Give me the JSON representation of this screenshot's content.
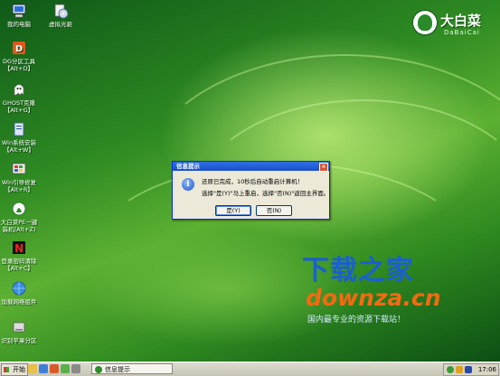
{
  "desktop": {
    "icons": [
      {
        "label": "我的电脑",
        "icon": "computer-icon"
      },
      {
        "label": "虚拟光驱",
        "icon": "cd-drive-icon"
      },
      {
        "label": "DG分区工具",
        "sub": "【Alt+D】",
        "icon": "partition-tool-icon"
      },
      {
        "label": "GHOST克隆",
        "sub": "【Alt+G】",
        "icon": "ghost-clone-icon"
      },
      {
        "label": "Win系统安装",
        "sub": "【Alt+W】",
        "icon": "windows-install-icon"
      },
      {
        "label": "Win引导修复",
        "sub": "【Alt+R】",
        "icon": "boot-repair-icon"
      },
      {
        "label": "大白菜PE一键",
        "sub": "装机(Alt+Z)",
        "icon": "dabaicai-onekey-icon"
      },
      {
        "label": "登录密码清除",
        "sub": "【Alt+C】",
        "icon": "password-clear-icon"
      },
      {
        "label": "加载网络组件",
        "icon": "network-load-icon"
      },
      {
        "label": "识别苹果分区",
        "icon": "apple-partition-icon"
      }
    ]
  },
  "logo": {
    "cn": "大白菜",
    "en": "DaBaiCai"
  },
  "watermark": {
    "cn": "下载之家",
    "url": "downza.cn",
    "slogan": "国内最专业的资源下载站！"
  },
  "dialog": {
    "title": "信息提示",
    "close": "×",
    "icon_glyph": "i",
    "message_line1": "还原已完成，10秒后自动重启计算机！",
    "message_line2": "选择\"是(Y)\"马上重启，选择\"否(N)\"返回主界面。",
    "yes_label": "是(Y)",
    "no_label": "否(N)"
  },
  "taskbar": {
    "start_label": "开始",
    "task_label": "信息提示",
    "clock": "17:06"
  }
}
